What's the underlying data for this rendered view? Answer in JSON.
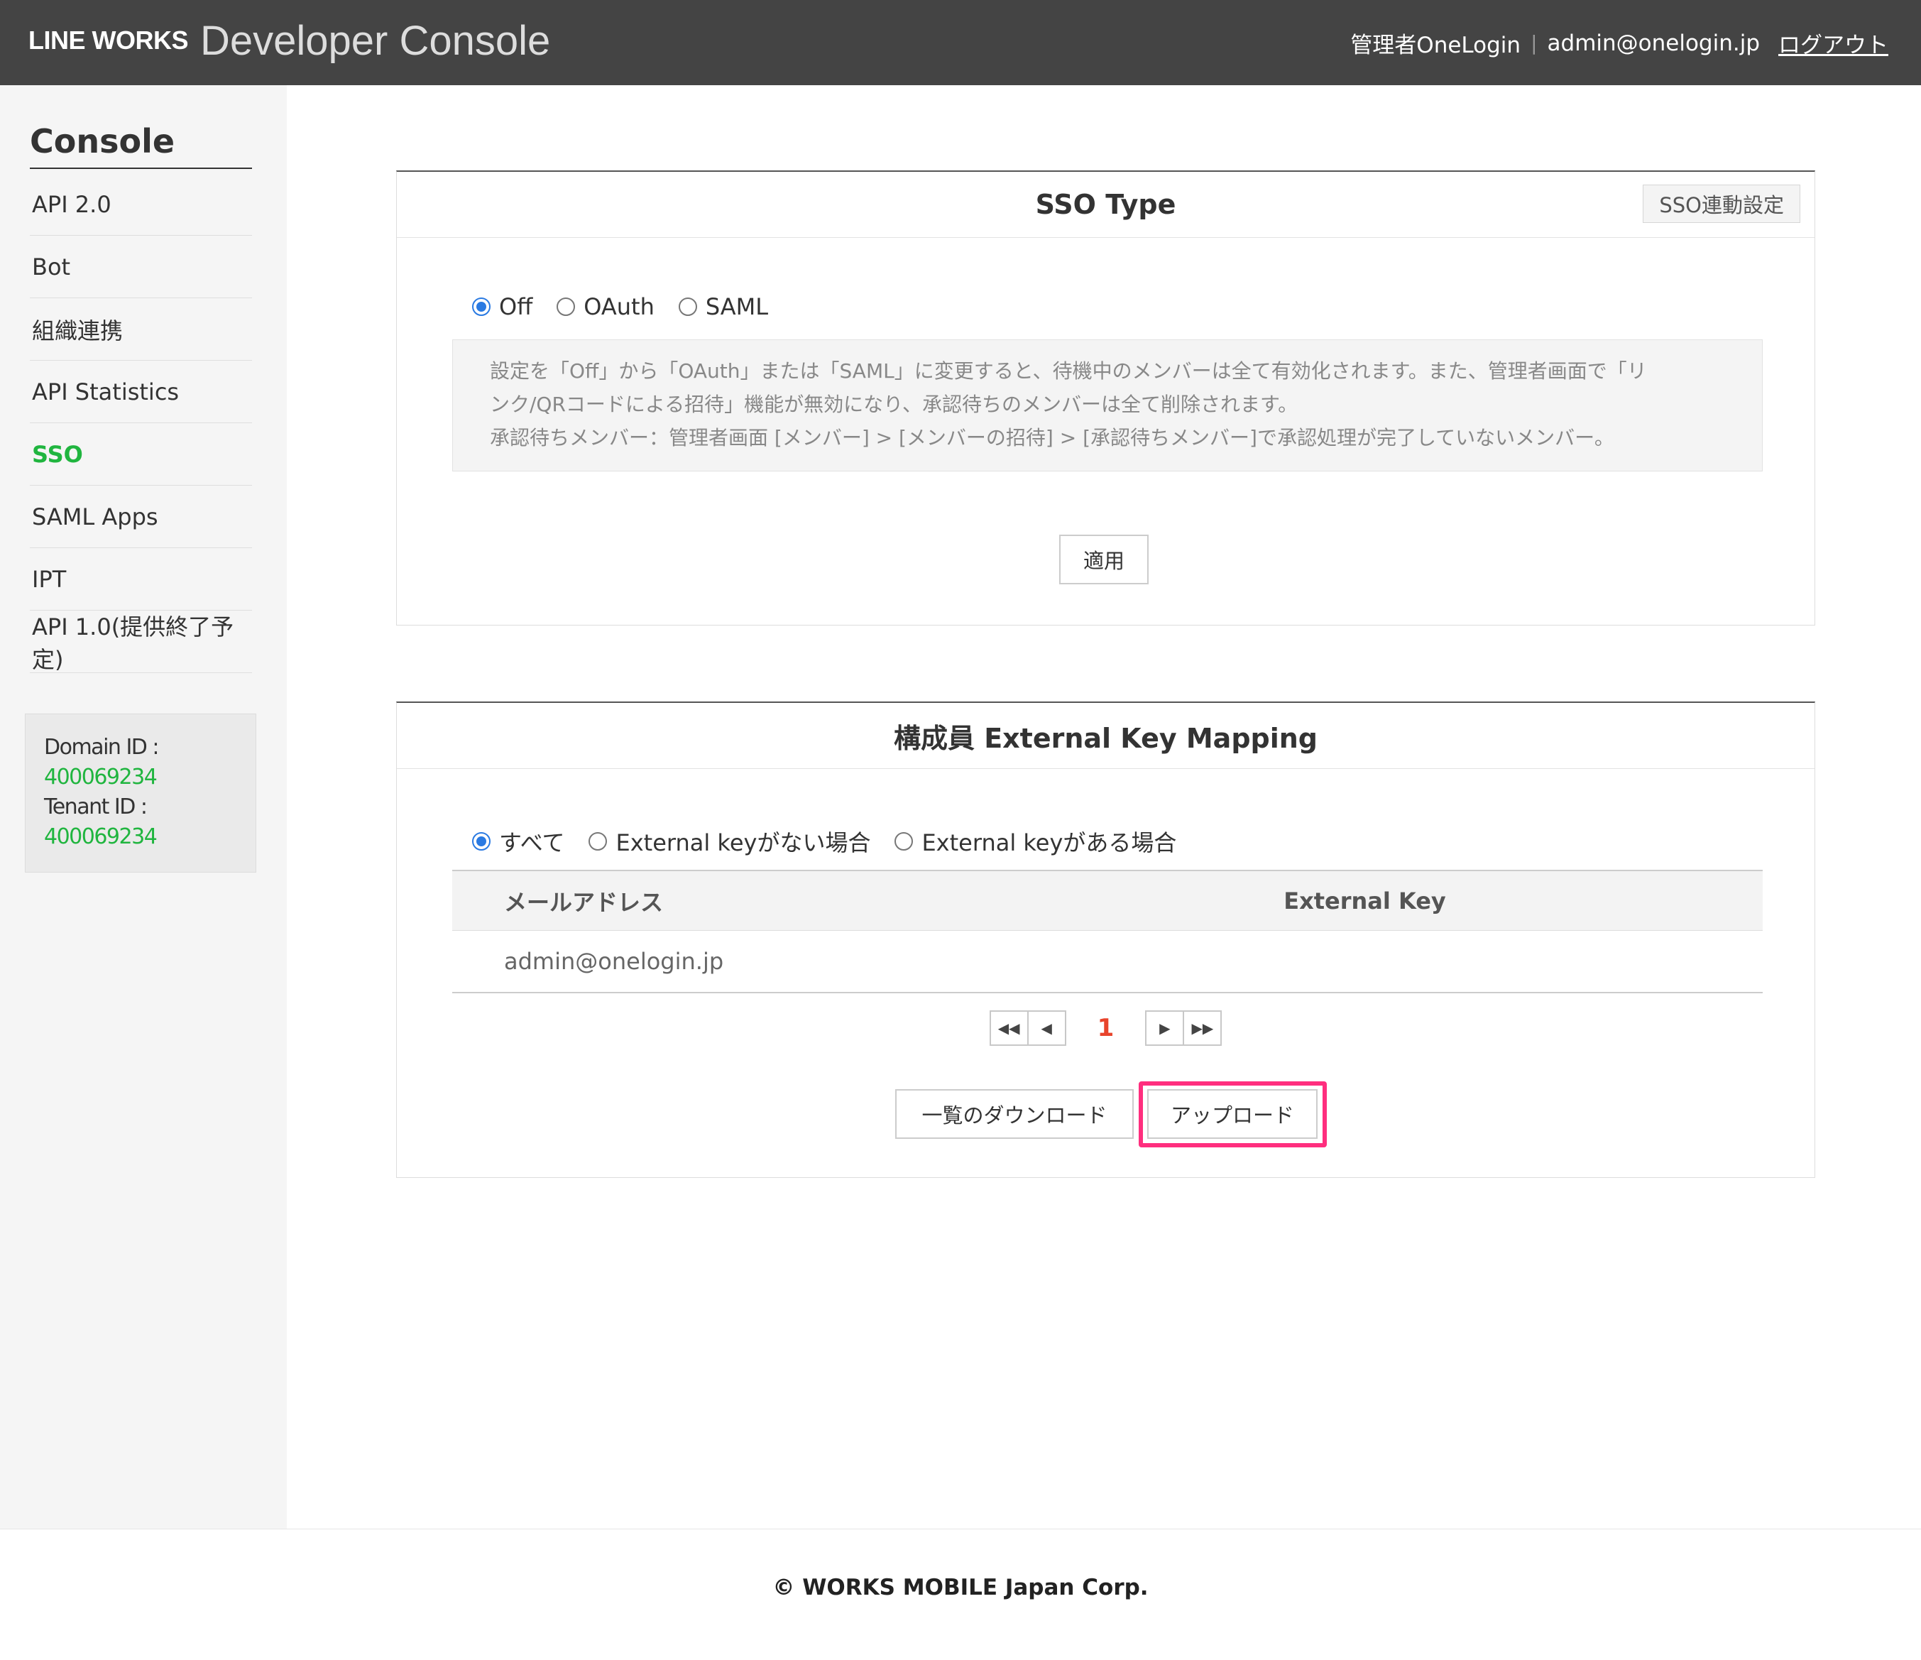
{
  "header": {
    "brand": "LINE WORKS",
    "app_name": "Developer Console",
    "user_name": "管理者OneLogin",
    "separator": "|",
    "email": "admin@onelogin.jp",
    "logout": "ログアウト"
  },
  "sidebar": {
    "title": "Console",
    "items": [
      {
        "label": "API 2.0"
      },
      {
        "label": "Bot"
      },
      {
        "label": "組織連携"
      },
      {
        "label": "API Statistics"
      },
      {
        "label": "SSO",
        "active": true
      },
      {
        "label": "SAML Apps"
      },
      {
        "label": "IPT"
      },
      {
        "label": "API 1.0(提供終了予定)"
      }
    ],
    "domain_label": "Domain ID :",
    "domain_id": "400069234",
    "tenant_label": "Tenant ID :",
    "tenant_id": "400069234"
  },
  "sso_panel": {
    "title": "SSO Type",
    "settings_button": "SSO連動設定",
    "options": [
      {
        "label": "Off",
        "checked": true
      },
      {
        "label": "OAuth",
        "checked": false
      },
      {
        "label": "SAML",
        "checked": false
      }
    ],
    "notice_line1": "設定を「Off」から「OAuth」または「SAML」に変更すると、待機中のメンバーは全て有効化されます。また、管理者画面で「リ",
    "notice_line2": "ンク/QRコードによる招待」機能が無効になり、承認待ちのメンバーは全て削除されます。",
    "notice_line3": "承認待ちメンバー：管理者画面 [メンバー] > [メンバーの招待] > [承認待ちメンバー]で承認処理が完了していないメンバー。",
    "apply_button": "適用"
  },
  "mapping_panel": {
    "title": "構成員 External Key Mapping",
    "filters": [
      {
        "label": "すべて",
        "checked": true
      },
      {
        "label": "External keyがない場合",
        "checked": false
      },
      {
        "label": "External keyがある場合",
        "checked": false
      }
    ],
    "columns": [
      "メールアドレス",
      "External Key"
    ],
    "rows": [
      {
        "email": "admin@onelogin.jp",
        "external_key": ""
      }
    ],
    "pagination": {
      "current_page": "1",
      "first_icon": "double-left-arrow",
      "prev_icon": "left-arrow",
      "next_icon": "right-arrow",
      "last_icon": "double-right-arrow"
    },
    "download_button": "一覧のダウンロード",
    "upload_button": "アップロード",
    "highlight_color": "#ff2e7e"
  },
  "footer": {
    "copyright": "© WORKS MOBILE Japan Corp."
  },
  "colors": {
    "header_bg": "#444444",
    "active_nav": "#20b53f",
    "radio_selected": "#2a7ae2",
    "current_page": "#e8442c"
  }
}
